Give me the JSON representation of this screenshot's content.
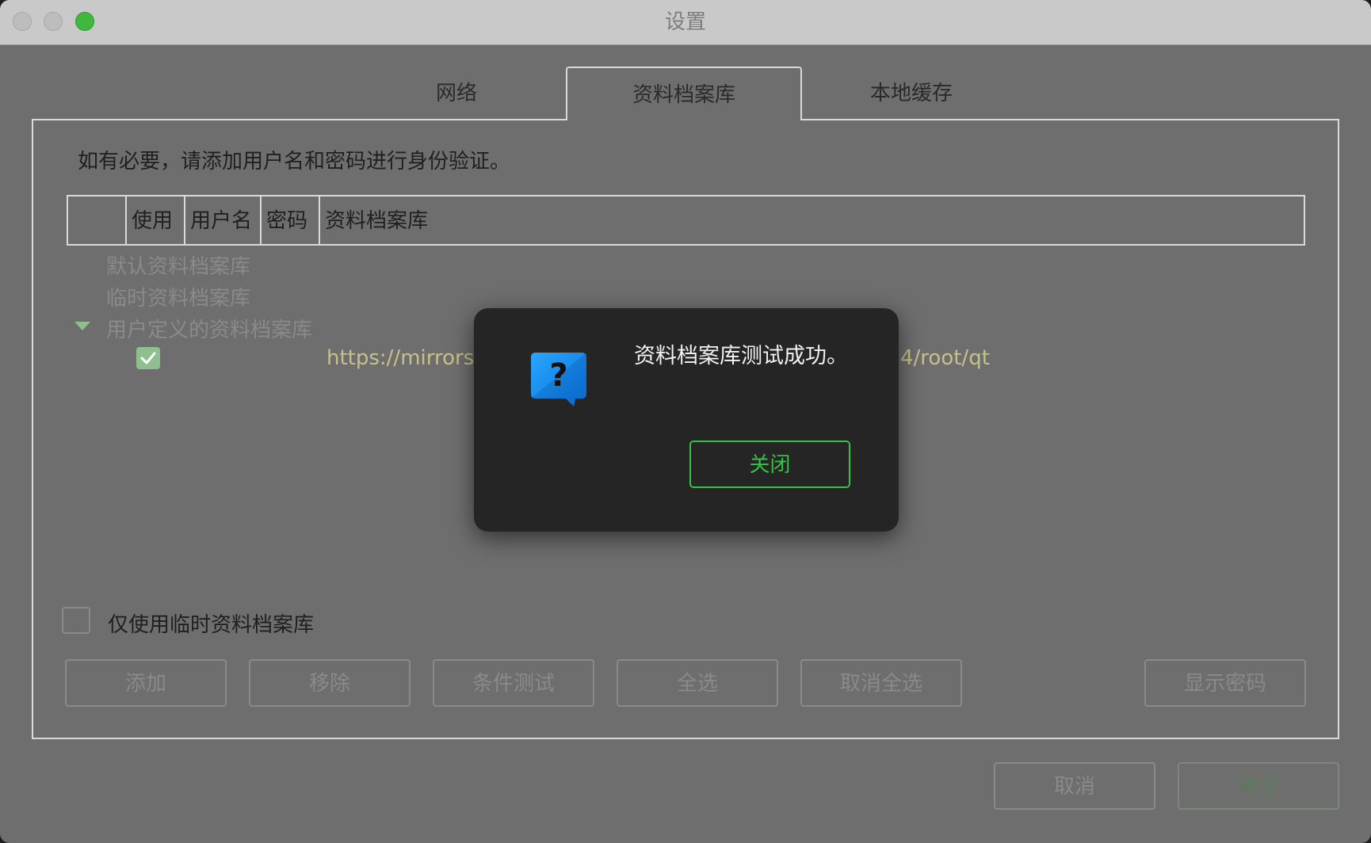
{
  "window": {
    "title": "设置"
  },
  "tabs": [
    {
      "label": "网络"
    },
    {
      "label": "资料档案库"
    },
    {
      "label": "本地缓存"
    }
  ],
  "hint": "如有必要，请添加用户名和密码进行身份验证。",
  "table": {
    "columns": [
      "",
      "使用",
      "用户名",
      "密码",
      "资料档案库"
    ],
    "tree": {
      "default_repo": "默认资料档案库",
      "temp_repo": "临时资料档案库",
      "user_repo": "用户定义的资料档案库",
      "entry_url_left": "https://mirrors.a",
      "entry_url_right": "4/root/qt"
    }
  },
  "only_temp_label": "仅使用临时资料档案库",
  "buttons": {
    "add": "添加",
    "remove": "移除",
    "test": "条件测试",
    "select_all": "全选",
    "deselect_all": "取消全选",
    "show_password": "显示密码",
    "cancel": "取消",
    "ok": "确定"
  },
  "dialog": {
    "message": "资料档案库测试成功。",
    "close_label": "关闭",
    "icon": "question-bubble-icon"
  },
  "colors": {
    "accent_green": "#36c243",
    "icon_blue": "#1e90ff"
  }
}
